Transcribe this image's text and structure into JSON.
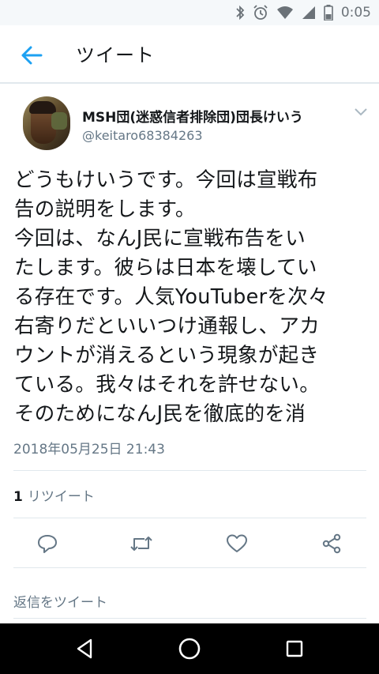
{
  "status_bar": {
    "time": "0:05",
    "icons": [
      "bluetooth-icon",
      "alarm-icon",
      "wifi-icon",
      "signal-icon",
      "battery-icon"
    ]
  },
  "app_bar": {
    "title": "ツイート",
    "back_icon": "arrow-left-icon"
  },
  "tweet": {
    "user": {
      "name": "MSH団(迷惑信者排除団)団長けいう",
      "handle": "@keitaro68384263"
    },
    "text": "どうもけいうです。今回は宣戦布\n告の説明をします。\n今回は、なんJ民に宣戦布告をい\nたします。彼らは日本を壊してい\nる存在です。人気YouTuberを次々\n右寄りだといいつけ通報し、アカ\nウントが消えるという現象が起き\nている。我々はそれを許せない。\nそのためになんJ民を徹底的を消",
    "timestamp": "2018年05月25日 21:43",
    "retweet_count": "1",
    "retweet_label": "リツイート",
    "actions": [
      "reply-icon",
      "retweet-icon",
      "like-icon",
      "share-icon"
    ]
  },
  "reply_placeholder": "返信をツイート",
  "nav_bar": [
    "back-triangle-icon",
    "home-circle-icon",
    "recents-square-icon"
  ],
  "colors": {
    "accent": "#1da1f2",
    "text": "#14171a",
    "secondary_text": "#657786",
    "divider": "#e1e8ed",
    "status_bar_bg": "#f5f8fa",
    "nav_bar_bg": "#000000"
  }
}
